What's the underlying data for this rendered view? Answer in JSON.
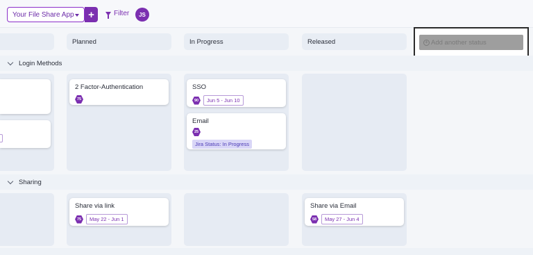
{
  "topbar": {
    "app_select_value": "Your File Share App",
    "add_button_label": "+",
    "filter_label": "Filter",
    "avatar_initials": "JS"
  },
  "columns": [
    {
      "label": "Planned"
    },
    {
      "label": "In Progress"
    },
    {
      "label": "Released"
    }
  ],
  "add_status_label": "Add another status",
  "groups": [
    {
      "label": "Login Methods",
      "cards": [
        {
          "title": "2 Factor-Authentication",
          "badge": "75",
          "date": "",
          "jira": ""
        },
        {
          "title": "SSO",
          "badge": "90",
          "date": "Jun 5 - Jun 10",
          "jira": ""
        },
        {
          "title": "Email",
          "badge": "25",
          "date": "",
          "jira": "Jira Status: In Progress"
        }
      ]
    },
    {
      "label": "Sharing",
      "cards": [
        {
          "title": "Share via link",
          "badge": "75",
          "date": "May 22 - Jun 1",
          "jira": ""
        },
        {
          "title": "Share via Email",
          "badge": "58",
          "date": "May 27 - Jun 4",
          "jira": ""
        }
      ]
    }
  ],
  "colors": {
    "accent": "#7b2fb0",
    "lane_bg": "#e6ebf3",
    "page_bg": "#f4f6f9"
  }
}
